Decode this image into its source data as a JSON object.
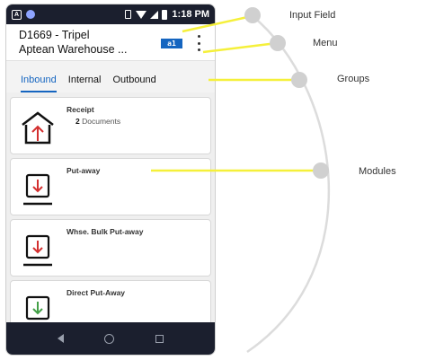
{
  "status_bar": {
    "time": "1:18 PM",
    "app_icon_text": "A"
  },
  "app_bar": {
    "title_line1": "D1669 - Tripel",
    "title_line2": "Aptean Warehouse ...",
    "input_button_label": "a1"
  },
  "tabs": [
    {
      "label": "Inbound",
      "active": true
    },
    {
      "label": "Internal",
      "active": false
    },
    {
      "label": "Outbound",
      "active": false
    }
  ],
  "modules": [
    {
      "title": "Receipt",
      "count": "2",
      "count_label": "Documents",
      "icon": "receipt-house-icon"
    },
    {
      "title": "Put-away",
      "icon": "put-away-icon"
    },
    {
      "title": "Whse. Bulk Put-away",
      "icon": "bulk-put-away-icon"
    },
    {
      "title": "Direct Put-Away",
      "icon": "direct-put-away-icon"
    }
  ],
  "annotations": {
    "input_field": "Input Field",
    "menu": "Menu",
    "groups": "Groups",
    "modules": "Modules"
  },
  "colors": {
    "accent": "#1565c0",
    "highlight_line": "#f5f03a",
    "icon_red": "#d32f2f",
    "icon_green": "#43a047",
    "system_bar": "#1b1f2e"
  }
}
